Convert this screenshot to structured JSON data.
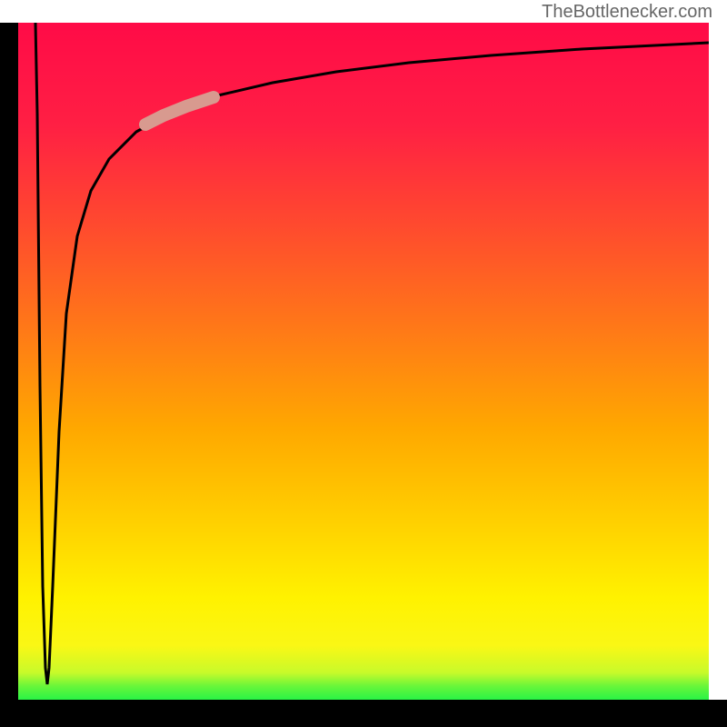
{
  "watermark": "TheBottlenecker.com",
  "chart_data": {
    "type": "line",
    "title": "",
    "xlabel": "",
    "ylabel": "",
    "xlim": [
      0,
      100
    ],
    "ylim": [
      0,
      100
    ],
    "gradient": {
      "colors": [
        "#29f346",
        "#aaf830",
        "#fff200",
        "#ffd800",
        "#ff9f00",
        "#ff5c1c",
        "#ff1744",
        "#ff0b47"
      ],
      "stops": [
        0,
        4,
        10,
        20,
        35,
        55,
        80,
        100
      ]
    },
    "curve": {
      "description": "Bottleneck curve starting from top-left, dipping sharply down to bottom, then rising steeply and curving asymptotically toward top-right",
      "points": [
        {
          "x": 2.5,
          "y": 100
        },
        {
          "x": 2.8,
          "y": 50
        },
        {
          "x": 3.2,
          "y": 20
        },
        {
          "x": 3.8,
          "y": 5
        },
        {
          "x": 4.2,
          "y": 2
        },
        {
          "x": 4.8,
          "y": 5
        },
        {
          "x": 5.5,
          "y": 20
        },
        {
          "x": 7,
          "y": 50
        },
        {
          "x": 9,
          "y": 65
        },
        {
          "x": 12,
          "y": 75
        },
        {
          "x": 18,
          "y": 82
        },
        {
          "x": 25,
          "y": 86
        },
        {
          "x": 35,
          "y": 89
        },
        {
          "x": 50,
          "y": 92
        },
        {
          "x": 70,
          "y": 94
        },
        {
          "x": 100,
          "y": 96
        }
      ]
    },
    "highlight": {
      "description": "Thick pale pink segment on upper-left curve",
      "color": "#d89a8f",
      "points": [
        {
          "x": 18,
          "y": 82
        },
        {
          "x": 28,
          "y": 87
        }
      ]
    }
  }
}
